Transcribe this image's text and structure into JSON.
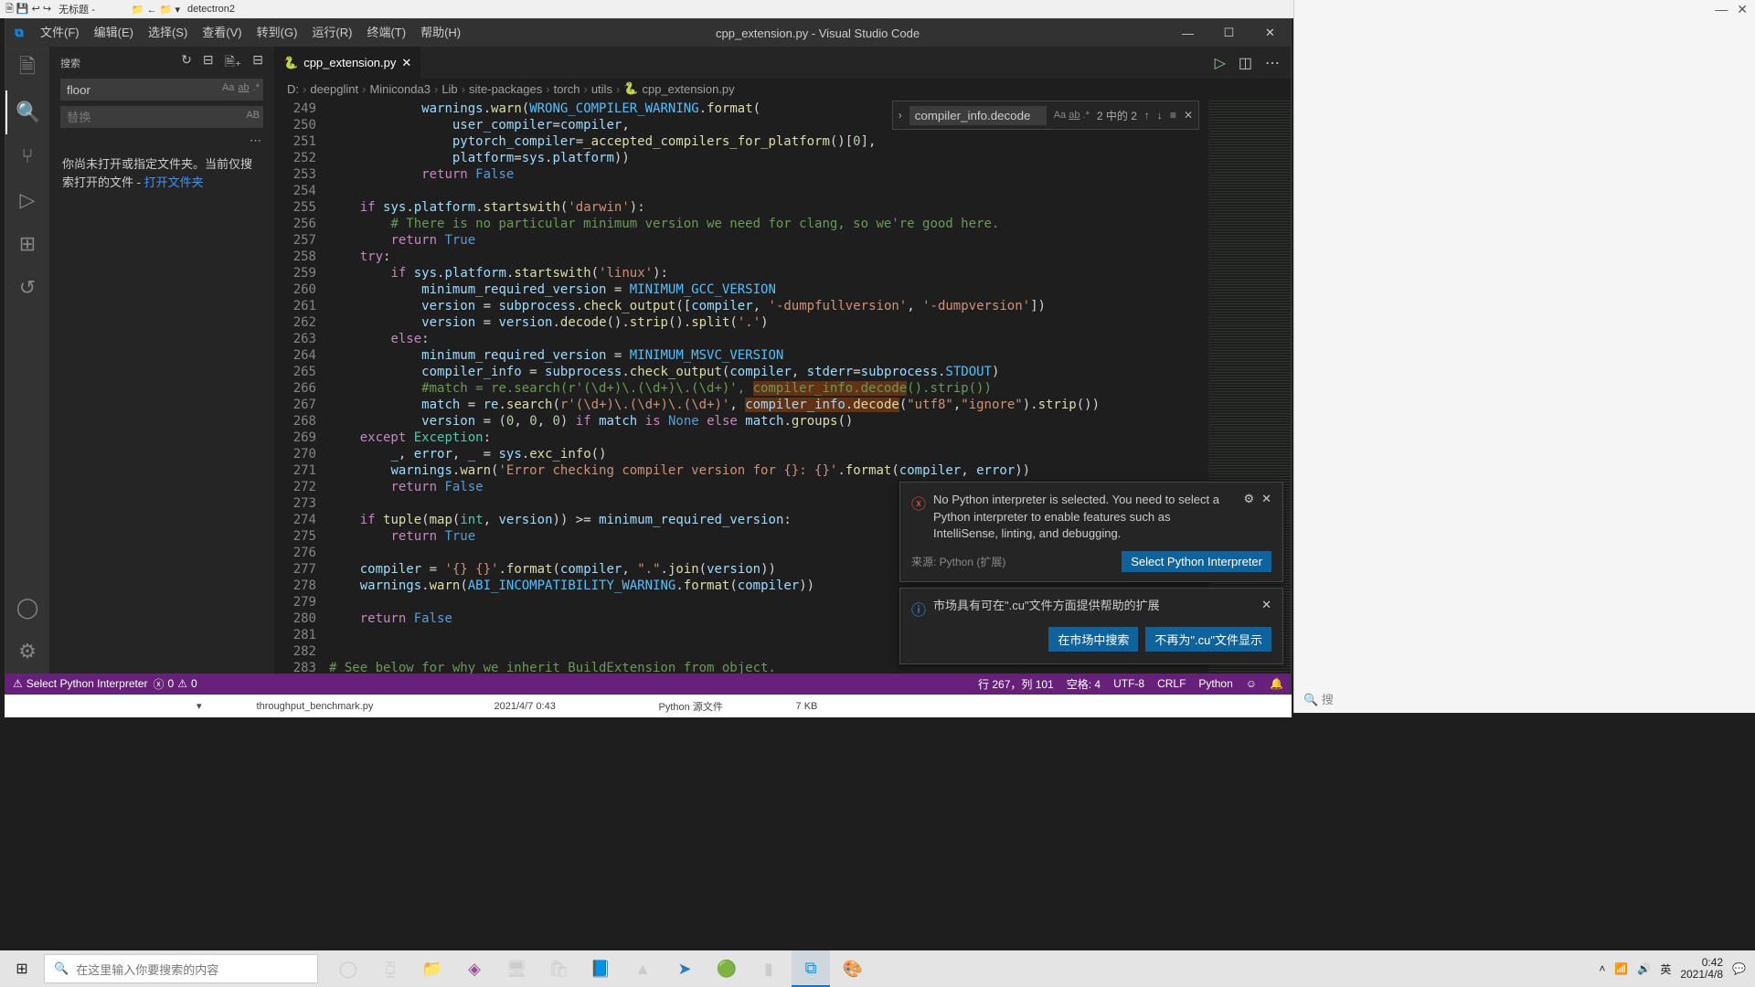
{
  "os_window1": "无标题 -",
  "os_window2": "detectron2",
  "titlebar": {
    "title": "cpp_extension.py - Visual Studio Code",
    "menu": [
      "文件(F)",
      "编辑(E)",
      "选择(S)",
      "查看(V)",
      "转到(G)",
      "运行(R)",
      "终端(T)",
      "帮助(H)"
    ]
  },
  "sidebar": {
    "header": "搜索",
    "search_value": "floor",
    "replace_placeholder": "替换",
    "msg_prefix": "你尚未打开或指定文件夹。当前仅搜索打开的文件 - ",
    "msg_link": "打开文件夹"
  },
  "tab": {
    "name": "cpp_extension.py"
  },
  "breadcrumb": [
    "D:",
    "deepglint",
    "Miniconda3",
    "Lib",
    "site-packages",
    "torch",
    "utils",
    "cpp_extension.py"
  ],
  "search_overlay": {
    "value": "compiler_info.decode",
    "count": "2 中的 2"
  },
  "line_start": 249,
  "line_end": 283,
  "notif1": {
    "msg": "No Python interpreter is selected. You need to select a Python interpreter to enable features such as IntelliSense, linting, and debugging.",
    "source": "来源: Python (扩展)",
    "btn": "Select Python Interpreter"
  },
  "notif2": {
    "msg": "市场具有可在\".cu\"文件方面提供帮助的扩展",
    "btn1": "在市场中搜索",
    "btn2": "不再为\".cu\"文件显示"
  },
  "status": {
    "interp": "Select Python Interpreter",
    "err": "0",
    "warn": "0",
    "pos": "行 267，列 101",
    "spaces": "空格: 4",
    "enc": "UTF-8",
    "eol": "CRLF",
    "lang": "Python"
  },
  "explorer_row": {
    "name": "throughput_benchmark.py",
    "date": "2021/4/7 0:43",
    "type": "Python 源文件",
    "size": "7 KB"
  },
  "taskbar": {
    "search_placeholder": "在这里输入你要搜索的内容",
    "ime": "英",
    "time": "0:42",
    "date": "2021/4/8"
  },
  "right_panel_search": "搜"
}
